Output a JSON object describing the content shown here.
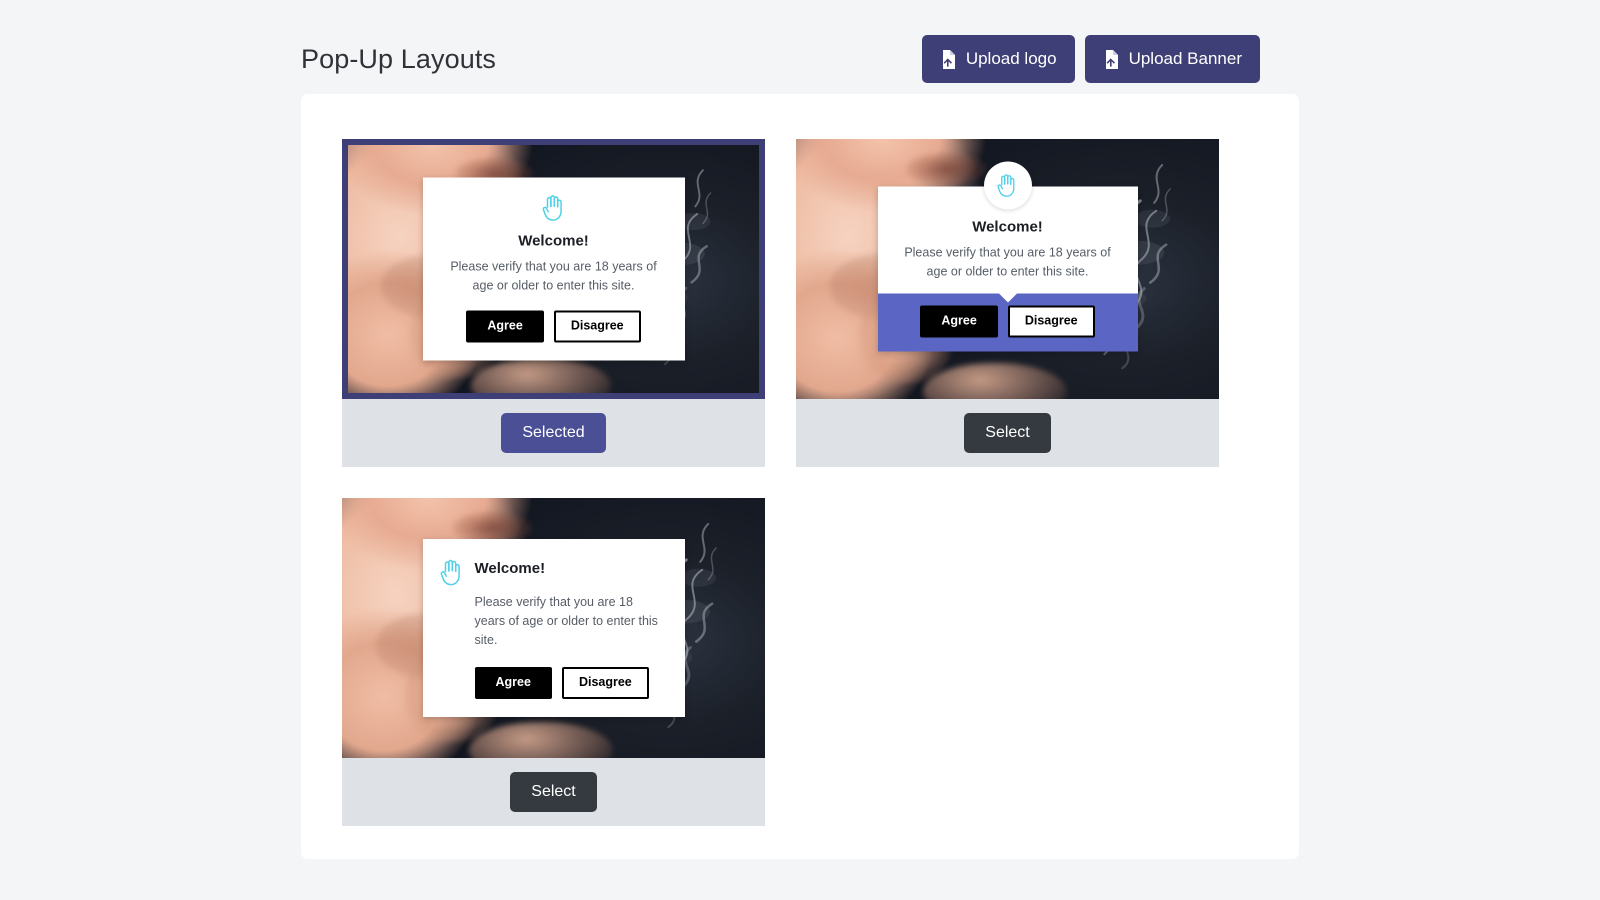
{
  "header": {
    "title": "Pop-Up Layouts",
    "buttons": [
      {
        "label": "Upload logo",
        "icon": "file-upload-icon"
      },
      {
        "label": "Upload Banner",
        "icon": "file-upload-icon"
      }
    ]
  },
  "popup_content": {
    "title": "Welcome!",
    "body": "Please verify that you are 18 years of age or older to enter this site.",
    "agree_label": "Agree",
    "disagree_label": "Disagree",
    "icon": "raised-hand-icon"
  },
  "cards": [
    {
      "variant": "centered",
      "selected": true,
      "action_label": "Selected"
    },
    {
      "variant": "badged-footer",
      "selected": false,
      "action_label": "Select"
    },
    {
      "variant": "inline-icon",
      "selected": false,
      "action_label": "Select"
    }
  ],
  "colors": {
    "page_background": "#f4f5f7",
    "panel_background": "#ffffff",
    "primary": "#3f3f77",
    "selected_button": "#4a4f96",
    "select_button": "#343a40",
    "footer_strip": "#dee2e6",
    "popup_accent_band": "#5b66c4",
    "icon_accent": "#4fd1e8",
    "selected_border": "#3f3f77"
  }
}
